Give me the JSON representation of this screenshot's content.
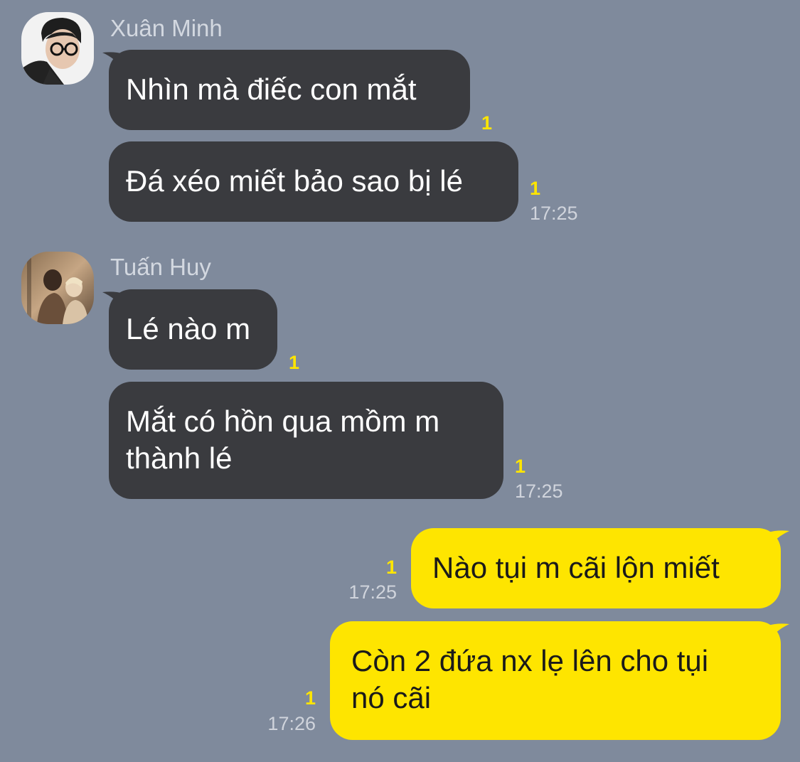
{
  "conversation": {
    "groups": [
      {
        "sender": "Xuân Minh",
        "messages": [
          {
            "text": "Nhìn mà điếc con mắt",
            "unread": "1"
          },
          {
            "text": "Đá xéo miết bảo sao bị lé",
            "unread": "1",
            "time": "17:25"
          }
        ]
      },
      {
        "sender": "Tuấn Huy",
        "messages": [
          {
            "text": "Lé nào m",
            "unread": "1"
          },
          {
            "text": "Mắt có hồn qua mồm m\nthành lé",
            "unread": "1",
            "time": "17:25"
          }
        ]
      }
    ],
    "outgoing": [
      {
        "text": "Nào tụi m cãi lộn miết",
        "unread": "1",
        "time": "17:25"
      },
      {
        "text": "Còn 2 đứa nx lẹ lên cho tụi\nnó cãi",
        "unread": "1",
        "time": "17:26"
      }
    ]
  },
  "colors": {
    "background": "#7f8a9c",
    "incoming_bubble": "#3a3b3f",
    "outgoing_bubble": "#fee500",
    "unread_count": "#fee500"
  },
  "icons": {
    "avatar_1": "profile-photo-man-glasses",
    "avatar_2": "profile-photo-couple"
  }
}
